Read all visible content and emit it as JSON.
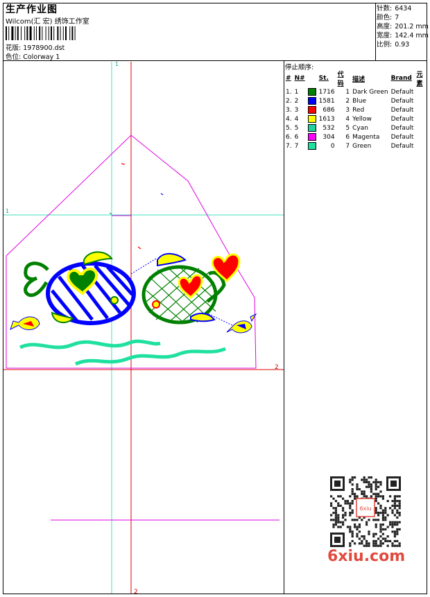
{
  "header": {
    "title": "生产作业图",
    "subtitle": "Wilcom(汇 宏) 绣饰工作室",
    "design_label": "花版:",
    "design_value": "1978900.dst",
    "colorway_label": "色位:",
    "colorway_value": "Colorway 1"
  },
  "stats": {
    "stitches_label": "针数:",
    "stitches_value": "6434",
    "colors_label": "颜色:",
    "colors_value": "7",
    "height_label": "高度:",
    "height_value": "201.2 mm",
    "width_label": "宽度:",
    "width_value": "142.4 mm",
    "scale_label": "比例:",
    "scale_value": "0.93"
  },
  "sequence": {
    "title": "停止顺序:",
    "headers": {
      "index": "#",
      "num": "N#",
      "st": "St.",
      "code": "代码",
      "desc": "描述",
      "brand": "Brand",
      "element": "元素"
    },
    "rows": [
      {
        "index": "1.",
        "num": "1",
        "color": "#008000",
        "st": "1716",
        "code": "1",
        "desc": "Dark Green",
        "brand": "Default"
      },
      {
        "index": "2.",
        "num": "2",
        "color": "#0000ff",
        "st": "1581",
        "code": "2",
        "desc": "Blue",
        "brand": "Default"
      },
      {
        "index": "3.",
        "num": "3",
        "color": "#ff0000",
        "st": "686",
        "code": "3",
        "desc": "Red",
        "brand": "Default"
      },
      {
        "index": "4.",
        "num": "4",
        "color": "#ffff00",
        "st": "1613",
        "code": "4",
        "desc": "Yellow",
        "brand": "Default"
      },
      {
        "index": "5.",
        "num": "5",
        "color": "#20d0a0",
        "st": "532",
        "code": "5",
        "desc": "Cyan",
        "brand": "Default"
      },
      {
        "index": "6.",
        "num": "6",
        "color": "#ff00ff",
        "st": "304",
        "code": "6",
        "desc": "Magenta",
        "brand": "Default"
      },
      {
        "index": "7.",
        "num": "7",
        "color": "#20e0a0",
        "st": "0",
        "code": "7",
        "desc": "Green",
        "brand": "Default"
      }
    ]
  },
  "guides": {
    "v1": "1",
    "h1": "1",
    "h2": "2",
    "v2": "2"
  },
  "watermark": {
    "text": "6xiu.com",
    "qr_label": "6xiu"
  },
  "colors": {
    "cyan_guide": "#40e0c0",
    "red_guide": "#e00000",
    "magenta_guide": "#e000e0",
    "magenta_outline": "#e000e0"
  }
}
